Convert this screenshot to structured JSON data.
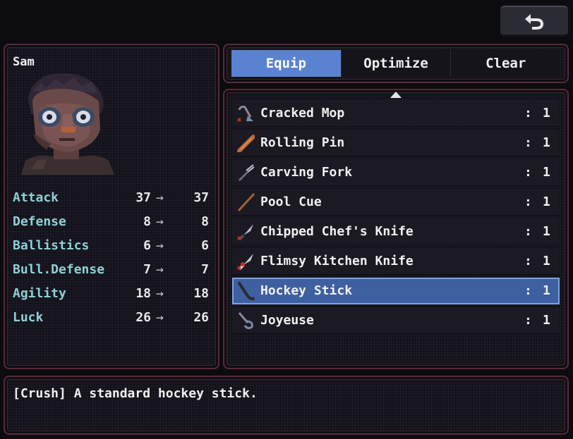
{
  "back_button": {
    "icon": "return-arrow-icon"
  },
  "character": {
    "name": "Sam",
    "stats": [
      {
        "label": "Attack",
        "from": "37",
        "to": "37"
      },
      {
        "label": "Defense",
        "from": "8",
        "to": "8"
      },
      {
        "label": "Ballistics",
        "from": "6",
        "to": "6"
      },
      {
        "label": "Bull.Defense",
        "from": "7",
        "to": "7"
      },
      {
        "label": "Agility",
        "from": "18",
        "to": "18"
      },
      {
        "label": "Luck",
        "from": "26",
        "to": "26"
      }
    ],
    "arrow": "→"
  },
  "tabs": [
    {
      "label": "Equip",
      "active": true
    },
    {
      "label": "Optimize",
      "active": false
    },
    {
      "label": "Clear",
      "active": false
    }
  ],
  "items": [
    {
      "name": "Cracked Mop",
      "colon": ":",
      "qty": "1",
      "icon": "mop-icon"
    },
    {
      "name": "Rolling Pin",
      "colon": ":",
      "qty": "1",
      "icon": "rolling-pin-icon"
    },
    {
      "name": "Carving Fork",
      "colon": ":",
      "qty": "1",
      "icon": "fork-icon"
    },
    {
      "name": "Pool Cue",
      "colon": ":",
      "qty": "1",
      "icon": "pool-cue-icon"
    },
    {
      "name": "Chipped Chef's Knife",
      "colon": ":",
      "qty": "1",
      "icon": "knife-icon"
    },
    {
      "name": "Flimsy Kitchen Knife",
      "colon": ":",
      "qty": "1",
      "icon": "bloody-knife-icon"
    },
    {
      "name": "Hockey Stick",
      "colon": ":",
      "qty": "1",
      "icon": "hockey-stick-icon",
      "selected": true
    },
    {
      "name": "Joyeuse",
      "colon": ":",
      "qty": "1",
      "icon": "hook-icon"
    }
  ],
  "description": "[Crush] A standard hockey stick.",
  "colors": {
    "accent": "#5a82d0",
    "selected_row": "#3e5fa0",
    "stat_label": "#8fd0d8",
    "panel_border": "#5a2a36"
  }
}
